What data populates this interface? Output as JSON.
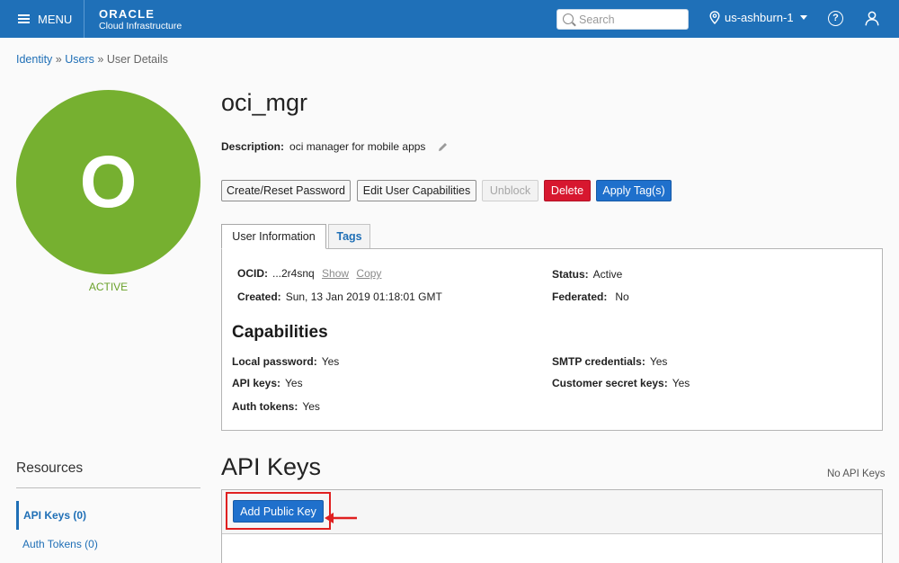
{
  "topbar": {
    "menu_label": "MENU",
    "brand_oracle": "ORACLE",
    "brand_sub": "Cloud Infrastructure",
    "search_placeholder": "Search",
    "region": "us-ashburn-1",
    "help_glyph": "?",
    "colors": {
      "bar": "#1f70b8"
    }
  },
  "breadcrumb": {
    "items": [
      "Identity",
      "Users",
      "User Details"
    ],
    "separator": "»"
  },
  "user": {
    "name": "oci_mgr",
    "avatar_letter": "O",
    "status": "ACTIVE",
    "description_label": "Description:",
    "description": "oci manager for mobile apps"
  },
  "actions": {
    "create_reset_password": "Create/Reset Password",
    "edit_capabilities": "Edit User Capabilities",
    "unblock": "Unblock",
    "delete": "Delete",
    "apply_tags": "Apply Tag(s)"
  },
  "tabs": {
    "user_information": "User Information",
    "tags": "Tags"
  },
  "info": {
    "ocid_label": "OCID:",
    "ocid_value": "...2r4snq",
    "show": "Show",
    "copy": "Copy",
    "created_label": "Created:",
    "created_value": "Sun, 13 Jan 2019 01:18:01 GMT",
    "status_label": "Status:",
    "status_value": "Active",
    "federated_label": "Federated:",
    "federated_value": "No"
  },
  "capabilities": {
    "heading": "Capabilities",
    "local_password_label": "Local password:",
    "local_password_value": "Yes",
    "api_keys_label": "API keys:",
    "api_keys_value": "Yes",
    "auth_tokens_label": "Auth tokens:",
    "auth_tokens_value": "Yes",
    "smtp_label": "SMTP credentials:",
    "smtp_value": "Yes",
    "customer_secret_label": "Customer secret keys:",
    "customer_secret_value": "Yes"
  },
  "resources": {
    "title": "Resources",
    "items": [
      "API Keys (0)",
      "Auth Tokens (0)"
    ]
  },
  "api_keys": {
    "heading": "API Keys",
    "empty_text": "No API Keys",
    "add_button": "Add Public Key",
    "highlight_color": "#e02020"
  }
}
